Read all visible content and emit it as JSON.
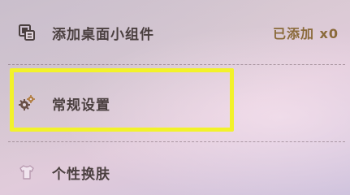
{
  "settings_menu": {
    "items": [
      {
        "label": "添加桌面小组件",
        "icon": "widget-screen-icon",
        "status": "已添加 x0"
      },
      {
        "label": "常规设置",
        "icon": "gear-icon"
      },
      {
        "label": "个性换肤",
        "icon": "shirt-icon"
      }
    ]
  },
  "highlight": {
    "color": "#f2f22a"
  },
  "colors": {
    "label_text": "#4a3f3f",
    "status_text": "#8a6a3a"
  }
}
